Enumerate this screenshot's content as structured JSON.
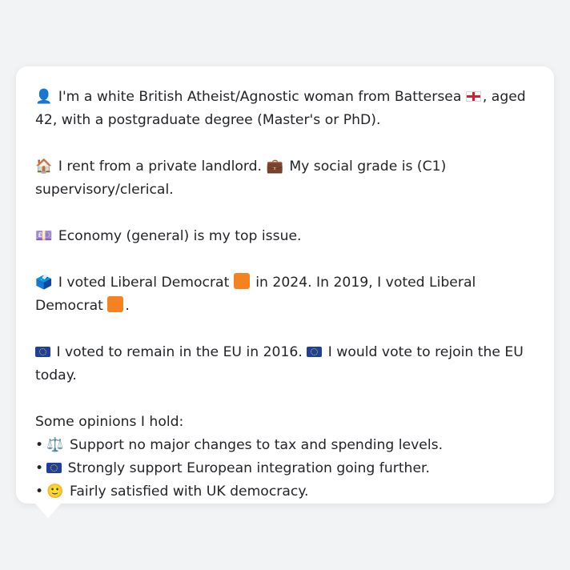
{
  "message": {
    "identity": {
      "icon": "👤",
      "text_before_flag": "I'm a white British Atheist/Agnostic woman from Battersea",
      "flag": "🏴",
      "text_after_flag": ", aged 42, with a postgraduate degree (Master's or PhD)."
    },
    "housing": {
      "house_icon": "🏠",
      "housing_text": "I rent from a private landlord.",
      "briefcase_icon": "💼",
      "grade_text": "My social grade is (C1) supervisory/clerical."
    },
    "issue": {
      "icon": "💷",
      "text": "Economy (general) is my top issue."
    },
    "votes": {
      "icon": "🗳️",
      "text_2024_before": "I voted Liberal Democrat",
      "party_square": "🟧",
      "text_2024_after": "in 2024. In 2019, I voted Liberal Democrat",
      "party_square_2": "🟧",
      "end": "."
    },
    "eu": {
      "flag_1": "🇪🇺",
      "text_1": "I voted to remain in the EU in 2016.",
      "flag_2": "🇪🇺",
      "text_2": "I would vote to rejoin the EU today."
    },
    "opinions": {
      "heading": "Some opinions I hold:",
      "items": [
        {
          "bullet": "•",
          "icon": "⚖️",
          "text": "Support no major changes to tax and spending levels."
        },
        {
          "bullet": "•",
          "icon": "🇪🇺",
          "text": "Strongly support European integration going further."
        },
        {
          "bullet": "•",
          "icon": "🙂",
          "text": "Fairly satisfied with UK democracy."
        }
      ]
    }
  },
  "colors": {
    "background": "#f2f3f5",
    "bubble": "#ffffff",
    "text": "#222428",
    "party_orange": "#f58220"
  }
}
